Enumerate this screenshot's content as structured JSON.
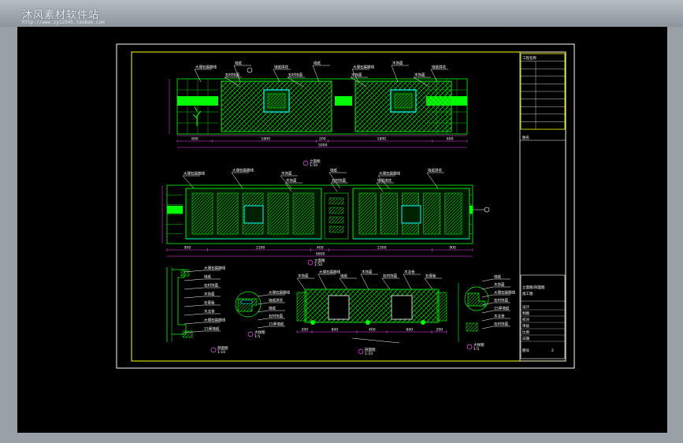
{
  "watermark": {
    "title": "沐风素材软件站",
    "url": "http://www.zy12345.taobao.com"
  },
  "drawing": {
    "colors": {
      "background": "#000000",
      "frame": "#ffffff",
      "border": "#ffff00",
      "geometry": "#00ff00",
      "hatch": "#00e000",
      "dims": "#ff44ff",
      "leader": "#ffffff",
      "accent": "#00ffff"
    },
    "elevation_labels": {
      "el1_top": [
        "大理石踢脚线",
        "墙纸",
        "墙纸拼花",
        "墙纸",
        "大理石踢脚线",
        "木饰面",
        "墙纸拼花"
      ],
      "el1_mid": [
        "石材饰面",
        "石材饰面",
        "木饰面",
        "木饰面"
      ],
      "el2_top": [
        "大理石踢脚线",
        "大理石踢脚线",
        "木饰面",
        "墙纸",
        "大理石踢脚线",
        "墙纸拼花"
      ],
      "el2_mid": [
        "木饰面",
        "石材饰面",
        "墙纸拼花"
      ],
      "sec_a": [
        "大理石踢脚线",
        "墙纸",
        "石材饰面",
        "木饰面",
        "石膏板",
        "木龙骨",
        "大理石踢脚线",
        "15厚墙纸"
      ],
      "sec_b": [
        "大理石踢脚线",
        "墙纸拼花",
        "墙纸",
        "石材饰面",
        "15厚墙纸"
      ],
      "sec_c": [
        "木饰面",
        "大理石踢脚线",
        "墙纸",
        "木饰面",
        "石材饰面",
        "木龙骨",
        "石膏板"
      ],
      "sec_d": [
        "墙纸",
        "木饰面",
        "大理石踢脚线",
        "石材饰面",
        "15厚墙纸",
        "木龙骨",
        "石材饰面"
      ]
    },
    "captions": {
      "el1": [
        "立面图",
        "1:50"
      ],
      "el2": [
        "立面图",
        "1:50"
      ],
      "sa": [
        "剖面图",
        "1:10"
      ],
      "sb": [
        "大样图",
        "1:5"
      ],
      "sc": [
        "剖面图",
        "1:10"
      ],
      "sd": [
        "大样图",
        "1:5"
      ]
    },
    "dims": {
      "el1_segments": [
        "600",
        "1800",
        "200",
        "1800",
        "600"
      ],
      "el1_total": "5000",
      "el2_segments": [
        "900",
        "2300",
        "400",
        "2300",
        "900"
      ],
      "el2_total": "6800",
      "sec_c_segments": [
        "200",
        "600",
        "400",
        "600",
        "200"
      ]
    },
    "title_block": {
      "header": "工程名称",
      "drawing_name": "图名",
      "mid_label": "立面图/剖面图",
      "sub_label": "施工图",
      "rows": [
        "设计",
        "制图",
        "校对",
        "审核",
        "比例",
        "日期"
      ],
      "sheet_label": "图号",
      "sheet_no": "2"
    }
  }
}
